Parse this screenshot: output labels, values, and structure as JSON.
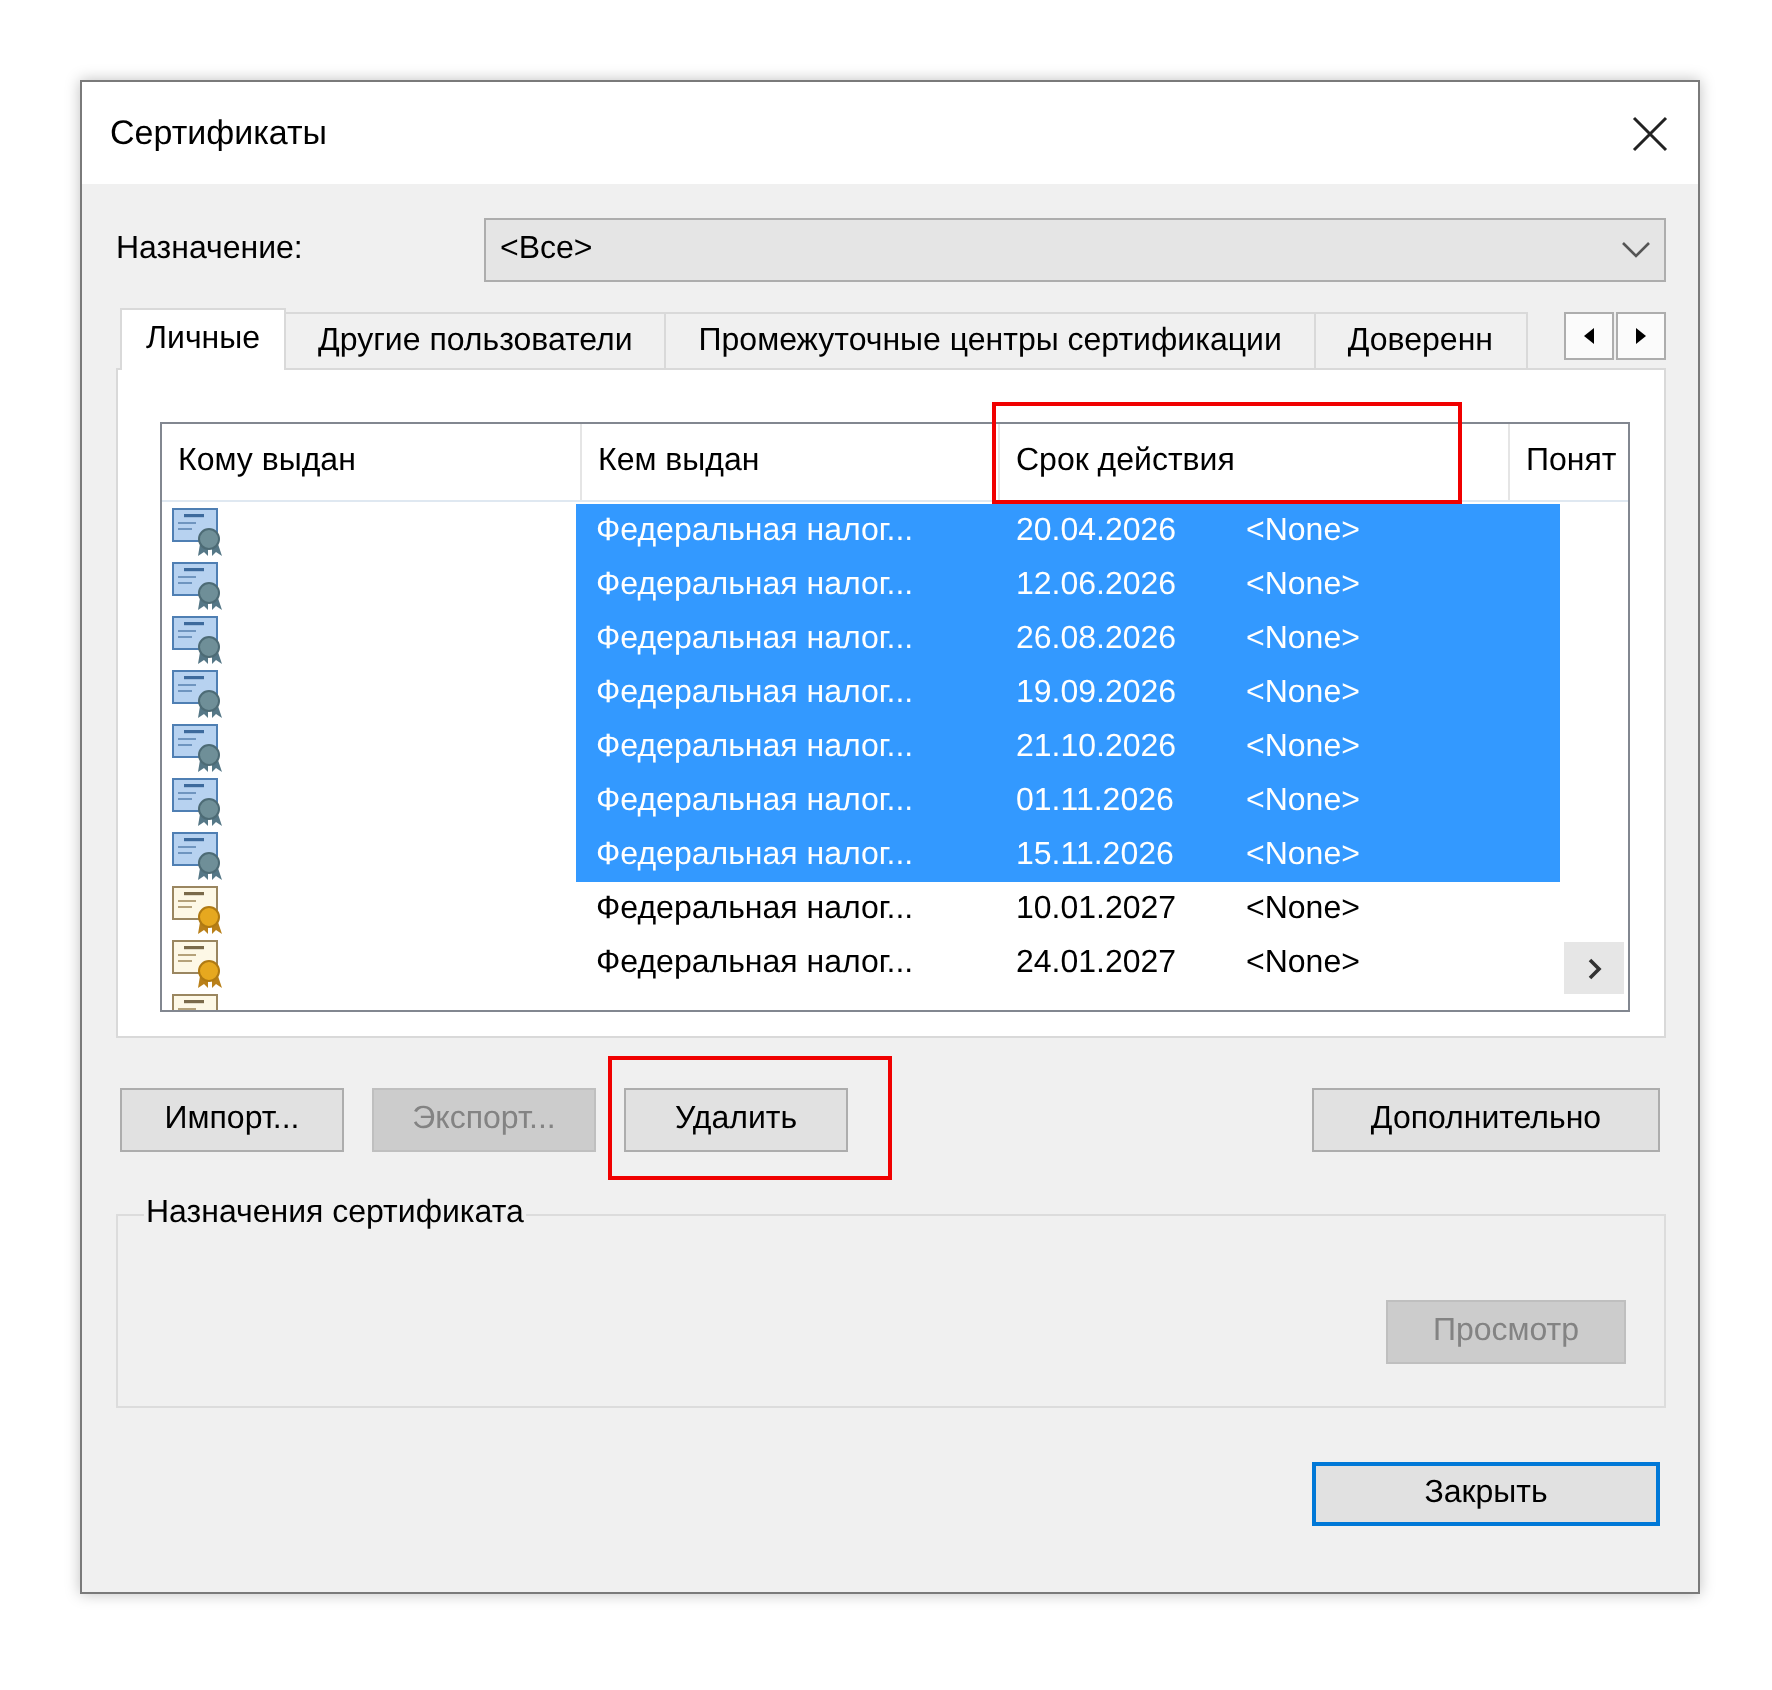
{
  "window": {
    "title": "Сертификаты"
  },
  "purpose": {
    "label": "Назначение:",
    "value": "<Все>"
  },
  "tabs": [
    {
      "label": "Личные",
      "selected": true
    },
    {
      "label": "Другие пользователи",
      "selected": false
    },
    {
      "label": "Промежуточные центры сертификации",
      "selected": false
    },
    {
      "label": "Доверенн",
      "selected": false
    }
  ],
  "table": {
    "columns": [
      {
        "label": "Кому выдан",
        "highlighted": false
      },
      {
        "label": "Кем выдан",
        "highlighted": false
      },
      {
        "label": "Срок действия",
        "highlighted": true
      },
      {
        "label": "Понят",
        "highlighted": false
      }
    ],
    "rows": [
      {
        "issued_by": "Федеральная налог...",
        "expires": "20.04.2026",
        "column_4": "<None>",
        "selected": true
      },
      {
        "issued_by": "Федеральная налог...",
        "expires": "12.06.2026",
        "column_4": "<None>",
        "selected": true
      },
      {
        "issued_by": "Федеральная налог...",
        "expires": "26.08.2026",
        "column_4": "<None>",
        "selected": true
      },
      {
        "issued_by": "Федеральная налог...",
        "expires": "19.09.2026",
        "column_4": "<None>",
        "selected": true
      },
      {
        "issued_by": "Федеральная налог...",
        "expires": "21.10.2026",
        "column_4": "<None>",
        "selected": true
      },
      {
        "issued_by": "Федеральная налог...",
        "expires": "01.11.2026",
        "column_4": "<None>",
        "selected": true
      },
      {
        "issued_by": "Федеральная налог...",
        "expires": "15.11.2026",
        "column_4": "<None>",
        "selected": true
      },
      {
        "issued_by": "Федеральная налог...",
        "expires": "10.01.2027",
        "column_4": "<None>",
        "selected": false
      },
      {
        "issued_by": "Федеральная налог...",
        "expires": "24.01.2027",
        "column_4": "<None>",
        "selected": false
      },
      {
        "selected": false
      }
    ]
  },
  "actions": [
    {
      "label": "Импорт...",
      "disabled": false,
      "highlighted": false
    },
    {
      "label": "Экспорт...",
      "disabled": true,
      "highlighted": false
    },
    {
      "label": "Удалить",
      "disabled": false,
      "highlighted": true
    }
  ],
  "advanced_button": {
    "label": "Дополнительно",
    "disabled": false
  },
  "purposes_group": {
    "title": "Назначения сертификата",
    "button": {
      "label": "Просмотр",
      "disabled": true
    }
  },
  "close_button": {
    "label": "Закрыть",
    "default": true
  }
}
